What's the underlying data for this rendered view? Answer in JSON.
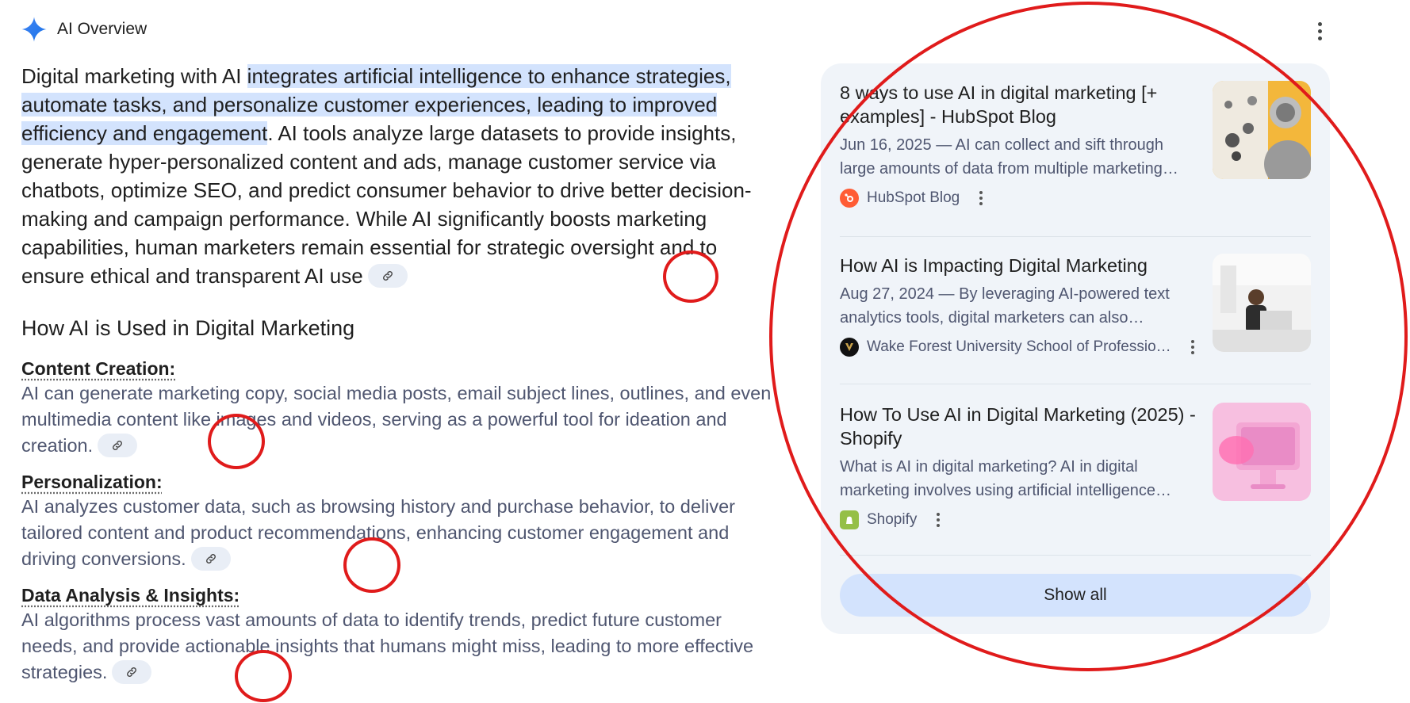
{
  "header": {
    "title": "AI Overview"
  },
  "intro": {
    "lead": "Digital marketing with AI ",
    "highlight": "integrates artificial intelligence to enhance strategies, automate tasks, and personalize customer experiences, leading to improved efficiency and engagement",
    "rest": ". AI tools analyze large datasets to provide insights, generate hyper-personalized content and ads, manage customer service via chatbots, optimize SEO, and predict consumer behavior to drive better decision-making and campaign performance. While AI significantly boosts marketing capabilities, human marketers remain essential for strategic oversight and to ensure ethical and transparent AI use"
  },
  "section": {
    "title": "How AI is Used in Digital Marketing"
  },
  "items": [
    {
      "head": "Content Creation:",
      "body": "AI can generate marketing copy, social media posts, email subject lines, outlines, and even multimedia content like images and videos, serving as a powerful tool for ideation and creation."
    },
    {
      "head": "Personalization:",
      "body": "AI analyzes customer data, such as browsing history and purchase behavior, to deliver tailored content and product recommendations, enhancing customer engagement and driving conversions."
    },
    {
      "head": "Data Analysis & Insights:",
      "body": "AI algorithms process vast amounts of data to identify trends, predict future customer needs, and provide actionable insights that humans might miss, leading to more effective strategies."
    }
  ],
  "sources": [
    {
      "title": "8 ways to use AI in digital marketing [+ examples] - HubSpot Blog",
      "snippet": "Jun 16, 2025 — AI can collect and sift through large amounts of data from multiple marketing…",
      "source": "HubSpot Blog",
      "favicon": "hubspot-icon",
      "color": "#ff5c35"
    },
    {
      "title": "How AI is Impacting Digital Marketing",
      "snippet": "Aug 27, 2024 — By leveraging AI-powered text analytics tools, digital marketers can also…",
      "source": "Wake Forest University School of Professio…",
      "favicon": "wake-forest-icon",
      "color": "#9e7e38"
    },
    {
      "title": "How To Use AI in Digital Marketing (2025) - Shopify",
      "snippet": "What is AI in digital marketing? AI in digital marketing involves using artificial intelligence…",
      "source": "Shopify",
      "favicon": "shopify-icon",
      "color": "#95bf47"
    }
  ],
  "show_all": "Show all",
  "colors": {
    "highlight": "#d3e3fd",
    "panel": "#f0f4f9",
    "annotation": "#e01b1b"
  }
}
